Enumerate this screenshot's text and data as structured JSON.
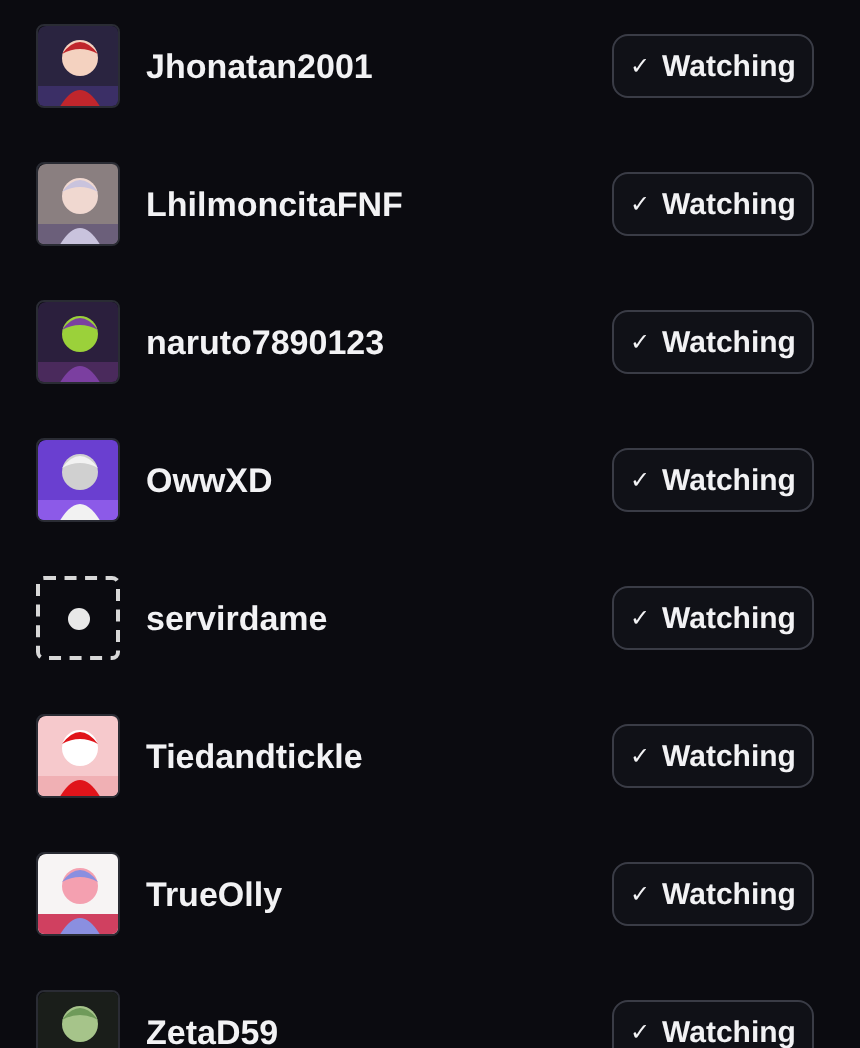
{
  "users": [
    {
      "name": "Jhonatan2001",
      "button": {
        "check": "✓",
        "label": "Watching"
      }
    },
    {
      "name": "LhilmoncitaFNF",
      "button": {
        "check": "✓",
        "label": "Watching"
      }
    },
    {
      "name": "naruto7890123",
      "button": {
        "check": "✓",
        "label": "Watching"
      }
    },
    {
      "name": "OwwXD",
      "button": {
        "check": "✓",
        "label": "Watching"
      }
    },
    {
      "name": "servirdame",
      "avatar": {
        "kind": "default"
      },
      "button": {
        "check": "✓",
        "label": "Watching"
      }
    },
    {
      "name": "Tiedandtickle",
      "button": {
        "check": "✓",
        "label": "Watching"
      }
    },
    {
      "name": "TrueOlly",
      "button": {
        "check": "✓",
        "label": "Watching"
      }
    },
    {
      "name": "ZetaD59",
      "button": {
        "check": "✓",
        "label": "Watching"
      }
    }
  ]
}
